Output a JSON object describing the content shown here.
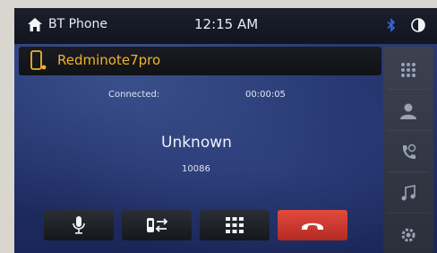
{
  "header": {
    "title": "BT Phone",
    "time": "12:15 AM",
    "icons": [
      "home-icon",
      "bluetooth-icon",
      "brightness-icon"
    ]
  },
  "device": {
    "name": "Redminote7pro",
    "icon": "phone-icon"
  },
  "call": {
    "status_label": "Connected:",
    "duration": "00:00:05",
    "caller_name": "Unknown",
    "caller_number": "10086"
  },
  "controls": [
    "microphone-icon",
    "audio-transfer-icon",
    "keypad-icon",
    "hang-up-icon"
  ],
  "sidebar": [
    "dialpad-icon",
    "contacts-icon",
    "call-log-icon",
    "music-icon",
    "settings-icon"
  ],
  "colors": {
    "accent": "#f0b42a",
    "hangup": "#d63a30",
    "background": "#25366f"
  }
}
